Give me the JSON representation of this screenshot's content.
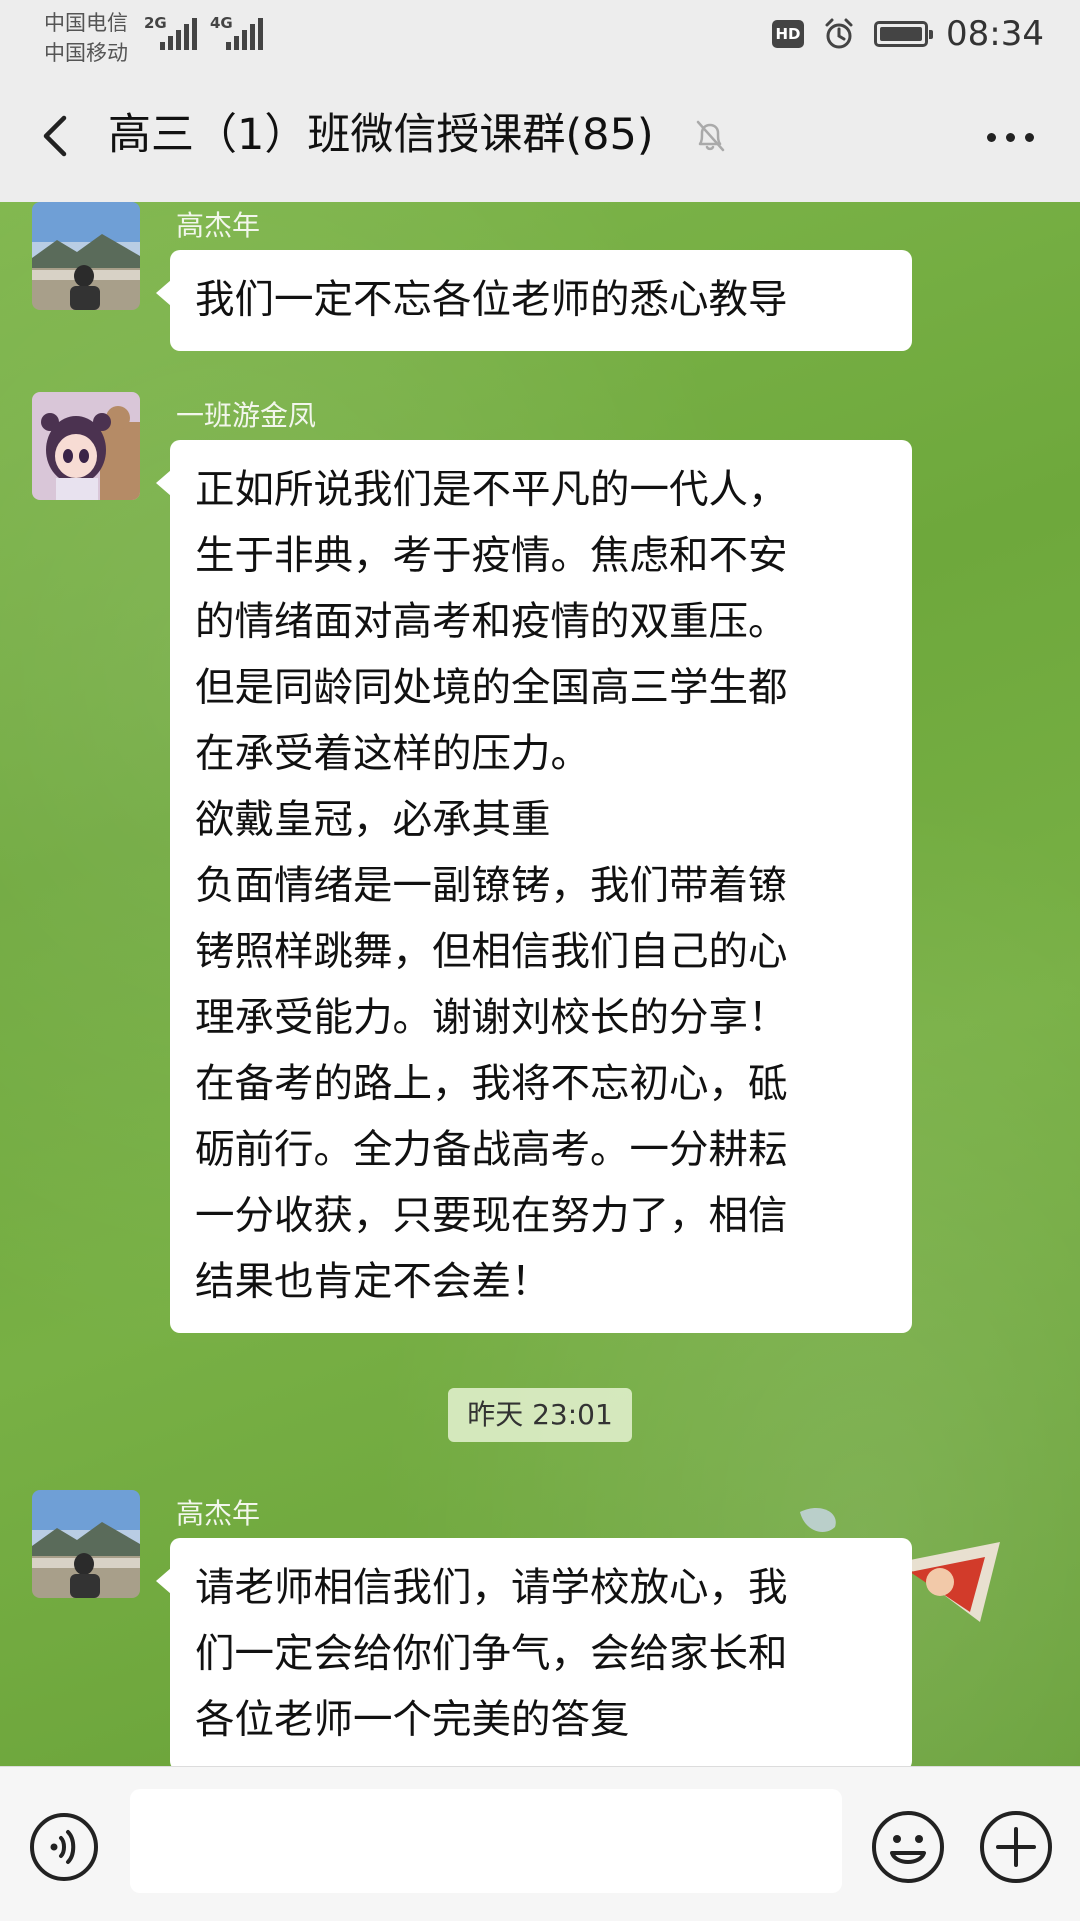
{
  "status_bar": {
    "carrier_1": "中国电信",
    "carrier_2": "中国移动",
    "signal_1_label": "2G",
    "signal_2_label": "4G",
    "hd_label": "HD",
    "time": "08:34"
  },
  "header": {
    "title": "高三（1）班微信授课群(85)",
    "icons": [
      "back-arrow-icon",
      "mute-bell-icon",
      "more-icon"
    ]
  },
  "messages": [
    {
      "sender": "高杰年",
      "text": "我们一定不忘各位老师的悉心教导"
    },
    {
      "sender": "一班游金凤",
      "text": "正如所说我们是不平凡的一代人，\n生于非典，考于疫情。焦虑和不安\n的情绪面对高考和疫情的双重压。\n但是同龄同处境的全国高三学生都\n在承受着这样的压力。\n欲戴皇冠，必承其重\n负面情绪是一副镣铐，我们带着镣\n铐照样跳舞，但相信我们自己的心\n理承受能力。谢谢刘校长的分享！\n在备考的路上，我将不忘初心，砥\n砺前行。全力备战高考。一分耕耘\n一分收获，只要现在努力了，相信\n结果也肯定不会差！"
    },
    {
      "sender": "高杰年",
      "text": "请老师相信我们，请学校放心，我\n们一定会给你们争气，会给家长和\n各位老师一个完美的答复"
    }
  ],
  "timestamp": "昨天 23:01",
  "input_bar": {
    "text_value": "",
    "icons": [
      "voice-icon",
      "emoji-icon",
      "plus-icon"
    ]
  },
  "colors": {
    "chat_background": "#74ad42",
    "bubble": "#ffffff",
    "bar_background": "#ededed"
  }
}
